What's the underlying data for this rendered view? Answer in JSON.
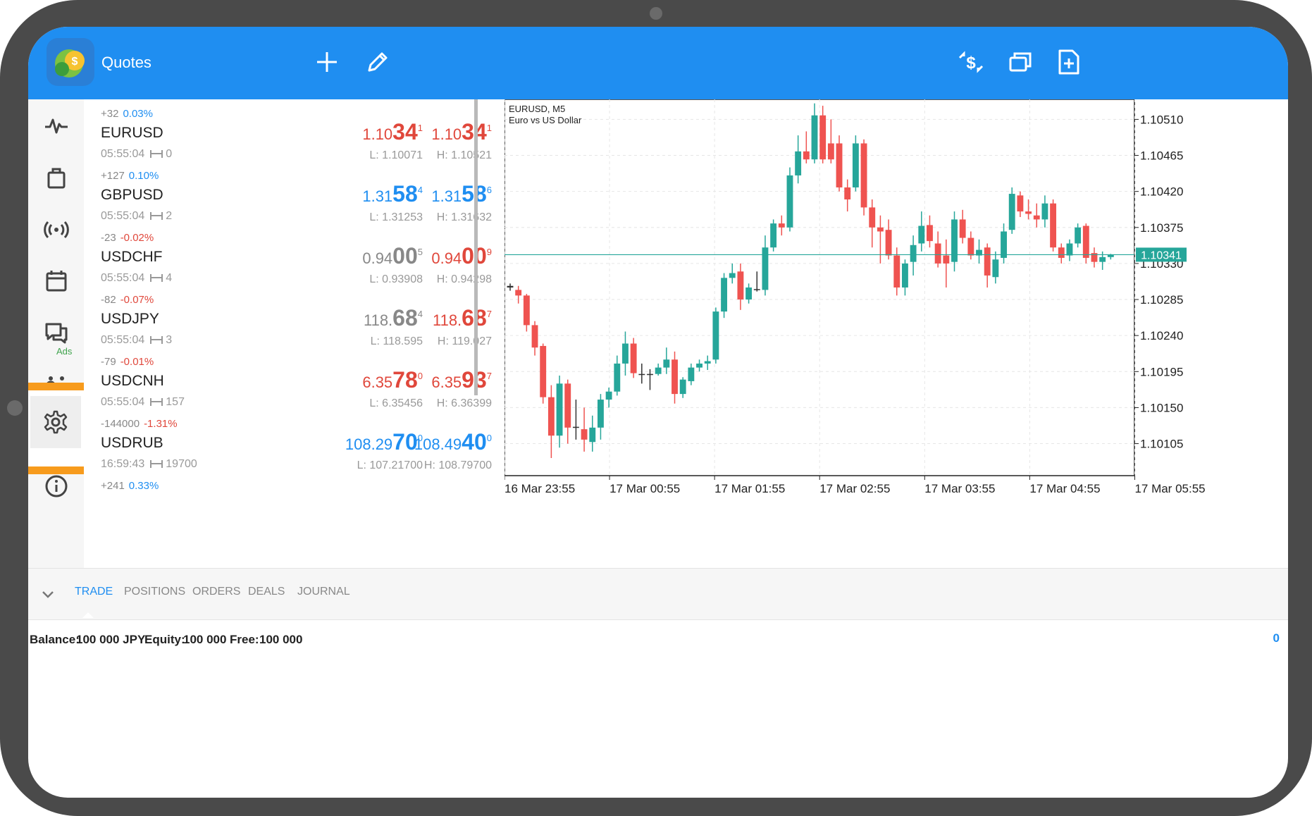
{
  "header": {
    "title": "Quotes",
    "icons": [
      "add-icon",
      "edit-icon",
      "currency-exchange-icon",
      "windows-icon",
      "new-document-icon"
    ]
  },
  "nav": {
    "items": [
      "quotes-icon",
      "trade-bag-icon",
      "signals-icon",
      "calendar-icon",
      "chat-icon",
      "community-icon",
      "settings-icon",
      "info-icon"
    ],
    "ads_label": "Ads"
  },
  "quotes": [
    {
      "change_points": "+32",
      "change_pct": "0.03%",
      "symbol": "EURUSD",
      "time": "05:55:04",
      "spread": "0",
      "bid": {
        "a": "1.10",
        "b": "34",
        "c": "1"
      },
      "ask": {
        "a": "1.10",
        "b": "34",
        "c": "1"
      },
      "low": "L: 1.10071",
      "high": "H: 1.10521",
      "color": "red"
    },
    {
      "change_points": "+127",
      "change_pct": "0.10%",
      "symbol": "GBPUSD",
      "time": "05:55:04",
      "spread": "2",
      "bid": {
        "a": "1.31",
        "b": "58",
        "c": "4"
      },
      "ask": {
        "a": "1.31",
        "b": "58",
        "c": "6"
      },
      "low": "L: 1.31253",
      "high": "H: 1.31632",
      "color": "blue"
    },
    {
      "change_points": "-23",
      "change_pct": "-0.02%",
      "symbol": "USDCHF",
      "time": "05:55:04",
      "spread": "4",
      "bid": {
        "a": "0.94",
        "b": "00",
        "c": "5"
      },
      "ask": {
        "a": "0.94",
        "b": "00",
        "c": "9"
      },
      "low": "L: 0.93908",
      "high": "H: 0.94298",
      "color": "gray-red"
    },
    {
      "change_points": "-82",
      "change_pct": "-0.07%",
      "symbol": "USDJPY",
      "time": "05:55:04",
      "spread": "3",
      "bid": {
        "a": "118.",
        "b": "68",
        "c": "4"
      },
      "ask": {
        "a": "118.",
        "b": "68",
        "c": "7"
      },
      "low": "L: 118.595",
      "high": "H: 119.027",
      "color": "gray-red"
    },
    {
      "change_points": "-79",
      "change_pct": "-0.01%",
      "symbol": "USDCNH",
      "time": "05:55:04",
      "spread": "157",
      "bid": {
        "a": "6.35",
        "b": "78",
        "c": "0"
      },
      "ask": {
        "a": "6.35",
        "b": "93",
        "c": "7"
      },
      "low": "L: 6.35456",
      "high": "H: 6.36399",
      "color": "red"
    },
    {
      "change_points": "-144000",
      "change_pct": "-1.31%",
      "symbol": "USDRUB",
      "time": "16:59:43",
      "spread": "19700",
      "bid": {
        "a": "108.29",
        "b": "70",
        "c": "0"
      },
      "ask": {
        "a": "108.49",
        "b": "40",
        "c": "0"
      },
      "low": "L: 107.21700",
      "high": "H: 108.79700",
      "color": "blue"
    },
    {
      "change_points": "+241",
      "change_pct": "0.33%",
      "symbol": "",
      "time": "",
      "spread": "",
      "bid": {
        "a": "",
        "b": "",
        "c": ""
      },
      "ask": {
        "a": "",
        "b": "",
        "c": ""
      },
      "low": "",
      "high": "",
      "color": "blue"
    }
  ],
  "chart_data": {
    "type": "candlestick",
    "symbol_label": "EURUSD, M5",
    "description": "Euro vs US Dollar",
    "ylim": [
      1.10065,
      1.10535
    ],
    "y_ticks": [
      "1.10510",
      "1.10465",
      "1.10420",
      "1.10375",
      "1.10330",
      "1.10285",
      "1.10240",
      "1.10195",
      "1.10150",
      "1.10105"
    ],
    "x_ticks": [
      "16 Mar 23:55",
      "17 Mar 00:55",
      "17 Mar 01:55",
      "17 Mar 02:55",
      "17 Mar 03:55",
      "17 Mar 04:55",
      "17 Mar 05:55"
    ],
    "current_price": "1.10341",
    "candles": [
      {
        "o": 1.10302,
        "h": 1.10305,
        "l": 1.10296,
        "c": 1.103
      },
      {
        "o": 1.10297,
        "h": 1.10302,
        "l": 1.1028,
        "c": 1.1029
      },
      {
        "o": 1.1029,
        "h": 1.10292,
        "l": 1.10245,
        "c": 1.10253
      },
      {
        "o": 1.10253,
        "h": 1.10258,
        "l": 1.10215,
        "c": 1.10225
      },
      {
        "o": 1.10227,
        "h": 1.1023,
        "l": 1.10155,
        "c": 1.10163
      },
      {
        "o": 1.10163,
        "h": 1.10178,
        "l": 1.10087,
        "c": 1.10115
      },
      {
        "o": 1.10115,
        "h": 1.1019,
        "l": 1.101,
        "c": 1.1018
      },
      {
        "o": 1.1018,
        "h": 1.10185,
        "l": 1.10105,
        "c": 1.10125
      },
      {
        "o": 1.10126,
        "h": 1.1016,
        "l": 1.1011,
        "c": 1.10126
      },
      {
        "o": 1.10123,
        "h": 1.1015,
        "l": 1.10095,
        "c": 1.1011
      },
      {
        "o": 1.10107,
        "h": 1.1014,
        "l": 1.10095,
        "c": 1.10125
      },
      {
        "o": 1.10125,
        "h": 1.10167,
        "l": 1.1011,
        "c": 1.1016
      },
      {
        "o": 1.1016,
        "h": 1.10175,
        "l": 1.1015,
        "c": 1.1017
      },
      {
        "o": 1.1017,
        "h": 1.10215,
        "l": 1.10165,
        "c": 1.10205
      },
      {
        "o": 1.10205,
        "h": 1.10245,
        "l": 1.1019,
        "c": 1.1023
      },
      {
        "o": 1.1023,
        "h": 1.10237,
        "l": 1.10187,
        "c": 1.10193
      },
      {
        "o": 1.10192,
        "h": 1.10205,
        "l": 1.1018,
        "c": 1.10192
      },
      {
        "o": 1.10192,
        "h": 1.10198,
        "l": 1.10172,
        "c": 1.10192
      },
      {
        "o": 1.10192,
        "h": 1.10205,
        "l": 1.1019,
        "c": 1.102
      },
      {
        "o": 1.102,
        "h": 1.10225,
        "l": 1.10192,
        "c": 1.1021
      },
      {
        "o": 1.1021,
        "h": 1.1022,
        "l": 1.10155,
        "c": 1.10167
      },
      {
        "o": 1.10167,
        "h": 1.10188,
        "l": 1.10162,
        "c": 1.10185
      },
      {
        "o": 1.10183,
        "h": 1.10205,
        "l": 1.10178,
        "c": 1.102
      },
      {
        "o": 1.102,
        "h": 1.1021,
        "l": 1.10195,
        "c": 1.10205
      },
      {
        "o": 1.10205,
        "h": 1.10215,
        "l": 1.10197,
        "c": 1.10208
      },
      {
        "o": 1.1021,
        "h": 1.10275,
        "l": 1.10205,
        "c": 1.1027
      },
      {
        "o": 1.1027,
        "h": 1.10318,
        "l": 1.10262,
        "c": 1.10312
      },
      {
        "o": 1.10312,
        "h": 1.1033,
        "l": 1.10305,
        "c": 1.10318
      },
      {
        "o": 1.1032,
        "h": 1.1033,
        "l": 1.10272,
        "c": 1.10285
      },
      {
        "o": 1.10285,
        "h": 1.10305,
        "l": 1.1028,
        "c": 1.103
      },
      {
        "o": 1.10298,
        "h": 1.1032,
        "l": 1.10295,
        "c": 1.10297
      },
      {
        "o": 1.10297,
        "h": 1.10365,
        "l": 1.1029,
        "c": 1.1035
      },
      {
        "o": 1.1035,
        "h": 1.10385,
        "l": 1.10345,
        "c": 1.1038
      },
      {
        "o": 1.1038,
        "h": 1.1039,
        "l": 1.10365,
        "c": 1.10375
      },
      {
        "o": 1.10375,
        "h": 1.1045,
        "l": 1.1037,
        "c": 1.1044
      },
      {
        "o": 1.1044,
        "h": 1.1049,
        "l": 1.1043,
        "c": 1.1047
      },
      {
        "o": 1.1047,
        "h": 1.10495,
        "l": 1.10455,
        "c": 1.1046
      },
      {
        "o": 1.1046,
        "h": 1.1053,
        "l": 1.10455,
        "c": 1.10515
      },
      {
        "o": 1.10515,
        "h": 1.10527,
        "l": 1.10455,
        "c": 1.1046
      },
      {
        "o": 1.1048,
        "h": 1.1051,
        "l": 1.10455,
        "c": 1.1046
      },
      {
        "o": 1.1048,
        "h": 1.1049,
        "l": 1.1042,
        "c": 1.10425
      },
      {
        "o": 1.10425,
        "h": 1.10435,
        "l": 1.10395,
        "c": 1.1041
      },
      {
        "o": 1.10425,
        "h": 1.1049,
        "l": 1.1042,
        "c": 1.1048
      },
      {
        "o": 1.1048,
        "h": 1.10485,
        "l": 1.1039,
        "c": 1.104
      },
      {
        "o": 1.104,
        "h": 1.1041,
        "l": 1.1035,
        "c": 1.10375
      },
      {
        "o": 1.10375,
        "h": 1.1039,
        "l": 1.1033,
        "c": 1.1037
      },
      {
        "o": 1.10372,
        "h": 1.10385,
        "l": 1.10335,
        "c": 1.1034
      },
      {
        "o": 1.1034,
        "h": 1.1035,
        "l": 1.1029,
        "c": 1.103
      },
      {
        "o": 1.103,
        "h": 1.10335,
        "l": 1.1029,
        "c": 1.1033
      },
      {
        "o": 1.10332,
        "h": 1.10365,
        "l": 1.10315,
        "c": 1.10353
      },
      {
        "o": 1.10355,
        "h": 1.10395,
        "l": 1.10345,
        "c": 1.10377
      },
      {
        "o": 1.10378,
        "h": 1.1039,
        "l": 1.1035,
        "c": 1.10358
      },
      {
        "o": 1.10355,
        "h": 1.1037,
        "l": 1.10325,
        "c": 1.1033
      },
      {
        "o": 1.1034,
        "h": 1.1036,
        "l": 1.103,
        "c": 1.1033
      },
      {
        "o": 1.10332,
        "h": 1.10395,
        "l": 1.1032,
        "c": 1.10385
      },
      {
        "o": 1.10385,
        "h": 1.10397,
        "l": 1.10355,
        "c": 1.10362
      },
      {
        "o": 1.10362,
        "h": 1.1037,
        "l": 1.10335,
        "c": 1.1034
      },
      {
        "o": 1.1034,
        "h": 1.1036,
        "l": 1.1033,
        "c": 1.10347
      },
      {
        "o": 1.1035,
        "h": 1.10355,
        "l": 1.103,
        "c": 1.10315
      },
      {
        "o": 1.10313,
        "h": 1.10345,
        "l": 1.10305,
        "c": 1.10335
      },
      {
        "o": 1.10337,
        "h": 1.1038,
        "l": 1.1033,
        "c": 1.1037
      },
      {
        "o": 1.10372,
        "h": 1.10425,
        "l": 1.10367,
        "c": 1.10417
      },
      {
        "o": 1.10415,
        "h": 1.1042,
        "l": 1.10388,
        "c": 1.10395
      },
      {
        "o": 1.10395,
        "h": 1.1041,
        "l": 1.10385,
        "c": 1.10392
      },
      {
        "o": 1.1039,
        "h": 1.10405,
        "l": 1.10375,
        "c": 1.10385
      },
      {
        "o": 1.10385,
        "h": 1.10415,
        "l": 1.10375,
        "c": 1.10405
      },
      {
        "o": 1.10405,
        "h": 1.1041,
        "l": 1.10345,
        "c": 1.1035
      },
      {
        "o": 1.1035,
        "h": 1.10355,
        "l": 1.1033,
        "c": 1.10337
      },
      {
        "o": 1.1034,
        "h": 1.1036,
        "l": 1.10333,
        "c": 1.10355
      },
      {
        "o": 1.10355,
        "h": 1.1038,
        "l": 1.1035,
        "c": 1.10375
      },
      {
        "o": 1.10377,
        "h": 1.1038,
        "l": 1.1033,
        "c": 1.10337
      },
      {
        "o": 1.10343,
        "h": 1.1035,
        "l": 1.10325,
        "c": 1.10332
      },
      {
        "o": 1.10332,
        "h": 1.10345,
        "l": 1.10322,
        "c": 1.10338
      },
      {
        "o": 1.10338,
        "h": 1.10342,
        "l": 1.10335,
        "c": 1.10341
      }
    ]
  },
  "tabs": {
    "items": [
      {
        "label": "TRADE",
        "active": true
      },
      {
        "label": "POSITIONS",
        "active": false
      },
      {
        "label": "ORDERS",
        "active": false
      },
      {
        "label": "DEALS",
        "active": false
      },
      {
        "label": "JOURNAL",
        "active": false
      }
    ]
  },
  "account": {
    "balance_label": "Balance:",
    "balance_value": "100 000 JPY",
    "equity_label": "Equity:",
    "equity_value": "100 000",
    "free_label": "Free:",
    "free_value": "100 000",
    "right_value": "0"
  },
  "colors": {
    "accent": "#1f8ef1",
    "bull": "#26a69a",
    "bear": "#ef5350",
    "highlight": "#f79b1d"
  }
}
